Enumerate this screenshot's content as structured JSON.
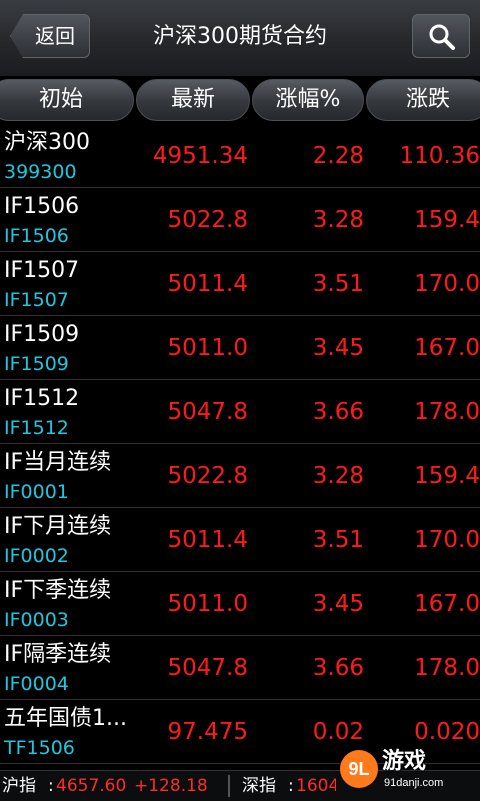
{
  "header": {
    "back_label": "返回",
    "title": "沪深300期货合约",
    "search_icon": "search-icon"
  },
  "columns": [
    "初始",
    "最新",
    "涨幅%",
    "涨跌"
  ],
  "rows": [
    {
      "name": "沪深300",
      "code": "399300",
      "price": "4951.34",
      "pct": "2.28",
      "change": "110.36"
    },
    {
      "name": "IF1506",
      "code": "IF1506",
      "price": "5022.8",
      "pct": "3.28",
      "change": "159.4"
    },
    {
      "name": "IF1507",
      "code": "IF1507",
      "price": "5011.4",
      "pct": "3.51",
      "change": "170.0"
    },
    {
      "name": "IF1509",
      "code": "IF1509",
      "price": "5011.0",
      "pct": "3.45",
      "change": "167.0"
    },
    {
      "name": "IF1512",
      "code": "IF1512",
      "price": "5047.8",
      "pct": "3.66",
      "change": "178.0"
    },
    {
      "name": "IF当月连续",
      "code": "IF0001",
      "price": "5022.8",
      "pct": "3.28",
      "change": "159.4"
    },
    {
      "name": "IF下月连续",
      "code": "IF0002",
      "price": "5011.4",
      "pct": "3.51",
      "change": "170.0"
    },
    {
      "name": "IF下季连续",
      "code": "IF0003",
      "price": "5011.0",
      "pct": "3.45",
      "change": "167.0"
    },
    {
      "name": "IF隔季连续",
      "code": "IF0004",
      "price": "5047.8",
      "pct": "3.66",
      "change": "178.0"
    },
    {
      "name": "五年国债1...",
      "code": "TF1506",
      "price": "97.475",
      "pct": "0.02",
      "change": "0.020"
    }
  ],
  "ticker": {
    "sh_label": "沪指",
    "sh_value": "4657.60",
    "sh_change": "+128.18",
    "sz_label": "深指",
    "sz_value": "1604"
  },
  "watermark": {
    "logo": "9L",
    "text": "游戏",
    "url": "91danji.com"
  },
  "colors": {
    "up": "#ff1a1a",
    "code": "#1fc7df",
    "background": "#000000"
  }
}
